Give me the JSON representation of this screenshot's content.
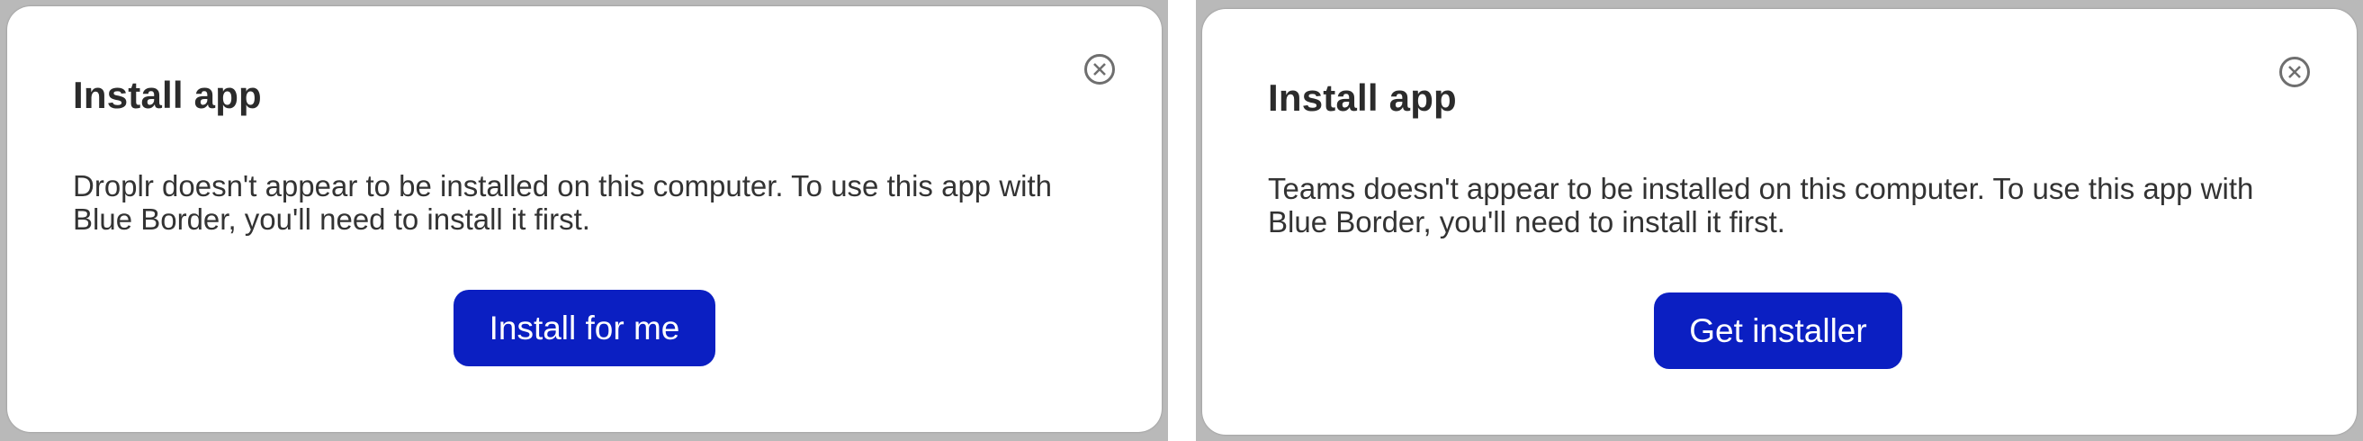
{
  "dialogs": [
    {
      "title": "Install app",
      "message": "Droplr doesn't appear to be installed on this computer. To use this app with Blue Border, you'll need to install it first.",
      "button_label": "Install for me",
      "close_icon": "close-circle-icon"
    },
    {
      "title": "Install app",
      "message": "Teams doesn't appear to be installed on this computer. To use this app with Blue Border, you'll need to install it first.",
      "button_label": "Get installer",
      "close_icon": "close-circle-icon"
    }
  ],
  "colors": {
    "button_bg": "#0b1fc2",
    "button_text": "#ffffff",
    "title_text": "#2b2b2b",
    "body_text": "#333333",
    "backdrop": "#b9b9b9"
  }
}
